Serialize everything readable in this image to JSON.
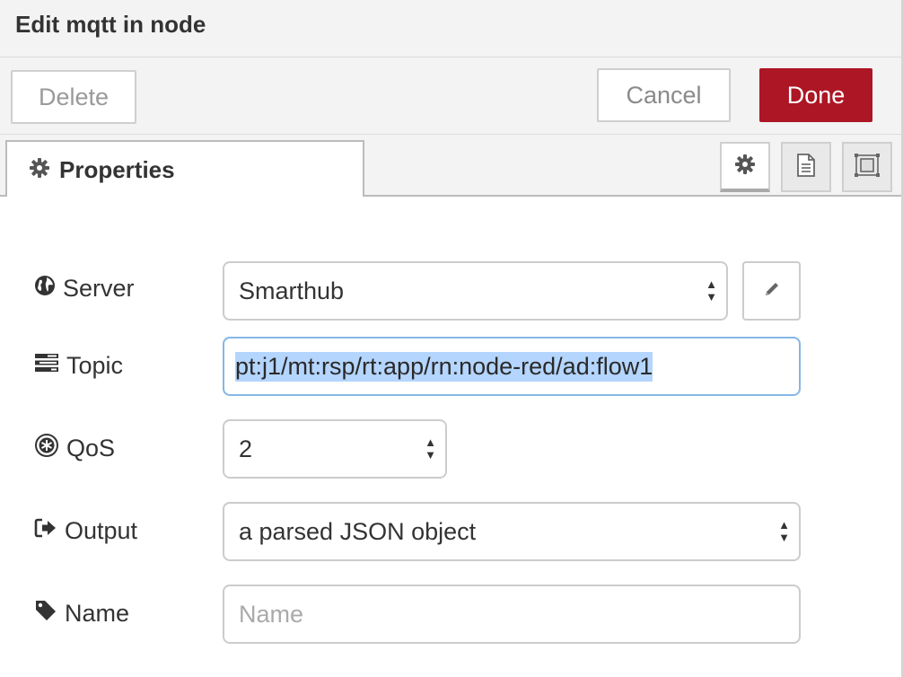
{
  "dialog": {
    "title": "Edit mqtt in node"
  },
  "toolbar": {
    "delete_label": "Delete",
    "cancel_label": "Cancel",
    "done_label": "Done",
    "done_color": "#ad1625"
  },
  "tabs": {
    "properties_label": "Properties",
    "icons": [
      "gear-icon",
      "description-icon",
      "appearance-icon"
    ]
  },
  "form": {
    "server": {
      "label": "Server",
      "value": "Smarthub",
      "icon": "globe-icon"
    },
    "topic": {
      "label": "Topic",
      "value": "pt:j1/mt:rsp/rt:app/rn:node-red/ad:flow1",
      "icon": "tasks-icon"
    },
    "qos": {
      "label": "QoS",
      "value": "2",
      "icon": "qos-icon"
    },
    "output": {
      "label": "Output",
      "value": "a parsed JSON object",
      "icon": "sign-out-icon"
    },
    "name": {
      "label": "Name",
      "placeholder": "Name",
      "value": "",
      "icon": "tag-icon"
    }
  }
}
